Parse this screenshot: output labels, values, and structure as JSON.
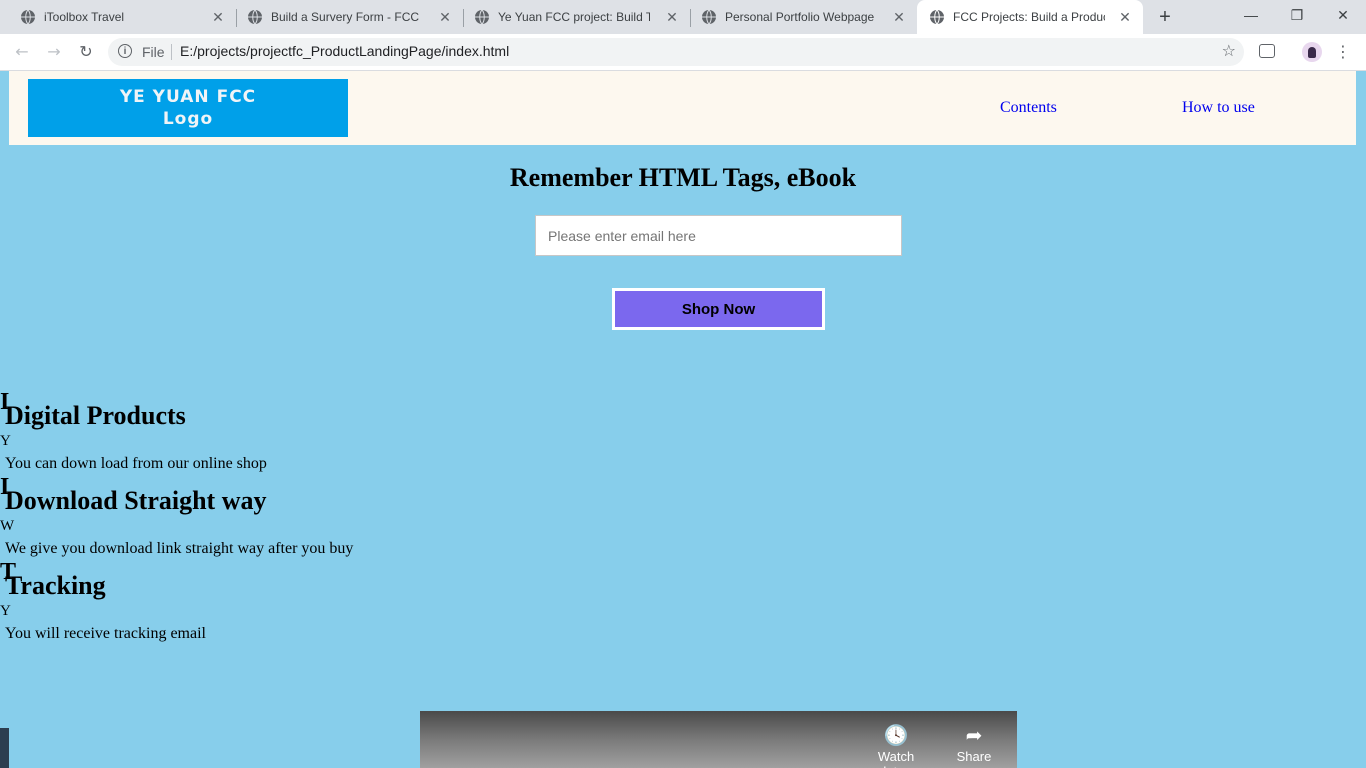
{
  "browser": {
    "tabs": [
      {
        "title": "iToolbox Travel",
        "active": false
      },
      {
        "title": "Build a Survery Form - FCC",
        "active": false
      },
      {
        "title": "Ye Yuan FCC project: Build Tech",
        "active": false
      },
      {
        "title": "Personal Portfolio Webpage - F",
        "active": false
      },
      {
        "title": "FCC Projects: Build a Products",
        "active": true
      }
    ],
    "new_tab": "+",
    "window_controls": {
      "minimize": "—",
      "maximize": "❐",
      "close": "✕"
    },
    "address": {
      "scheme_label": "File",
      "url": "E:/projects/projectfc_ProductLandingPage/index.html"
    }
  },
  "page": {
    "logo": {
      "line1": "YE YUAN FCC",
      "line2": "Logo"
    },
    "nav": [
      {
        "label": "Contents"
      },
      {
        "label": "How to use"
      }
    ],
    "hero": {
      "title": "Remember HTML Tags, eBook",
      "email_placeholder": "Please enter email here",
      "button": "Shop Now"
    },
    "features": [
      {
        "icon_letter": "I",
        "title": "Digital Products",
        "mini": "Y",
        "desc": "You can down load from our online shop"
      },
      {
        "icon_letter": "I",
        "title": "Download Straight way",
        "mini": "W",
        "desc": "We give you download link straight way after you buy"
      },
      {
        "icon_letter": "T",
        "title": "Tracking",
        "mini": "Y",
        "desc": "You will receive tracking email"
      }
    ],
    "video": {
      "watch_later": "Watch later",
      "share": "Share"
    }
  },
  "colors": {
    "page_bg": "#87ceeb",
    "header_bg": "#fdf8ef",
    "logo_bg": "#00a0e9",
    "button_bg": "#7b68ee",
    "link": "#0000ee"
  }
}
